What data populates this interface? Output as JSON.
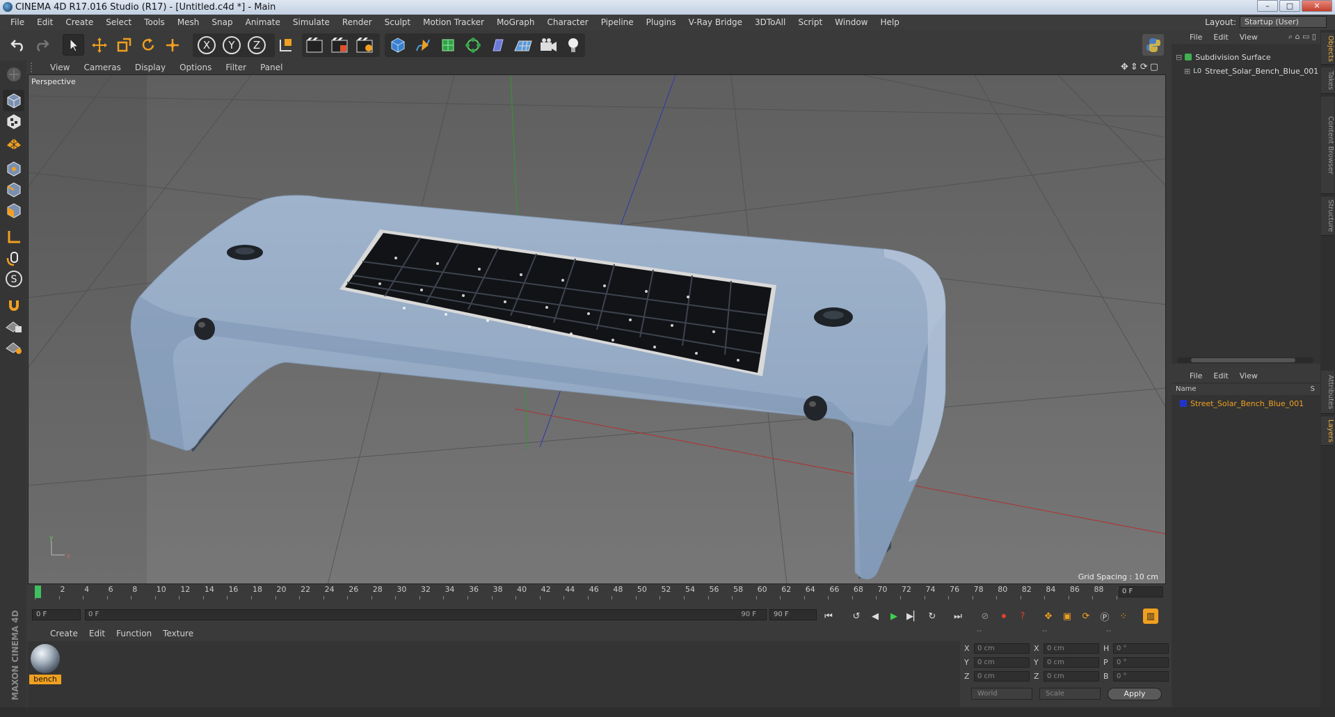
{
  "window": {
    "title": "CINEMA 4D R17.016 Studio (R17) - [Untitled.c4d *] - Main",
    "buttons": [
      "–",
      "□",
      "✕"
    ]
  },
  "menubar": {
    "items": [
      "File",
      "Edit",
      "Create",
      "Select",
      "Tools",
      "Mesh",
      "Snap",
      "Animate",
      "Simulate",
      "Render",
      "Sculpt",
      "Motion Tracker",
      "MoGraph",
      "Character",
      "Pipeline",
      "Plugins",
      "V-Ray Bridge",
      "3DToAll",
      "Script",
      "Window",
      "Help"
    ],
    "layout_label": "Layout:",
    "layout_value": "Startup (User)"
  },
  "toolbar": {
    "undo_icon": "undo-icon",
    "redo_icon": "redo-icon",
    "tools": [
      "select-icon",
      "move-icon",
      "scale-icon",
      "rotate-icon",
      "multi-icon"
    ],
    "axes": [
      "X",
      "Y",
      "Z"
    ],
    "accent": "#f0a020"
  },
  "viewport": {
    "menu": [
      "View",
      "Cameras",
      "Display",
      "Options",
      "Filter",
      "Panel"
    ],
    "label": "Perspective",
    "grid_spacing": "Grid Spacing : 10 cm",
    "background": "#6e6e6e",
    "bench_color": "#8fa5c0",
    "panel_color": "#151518"
  },
  "timeline": {
    "ticks": [
      "0",
      "2",
      "4",
      "6",
      "8",
      "10",
      "12",
      "14",
      "16",
      "18",
      "20",
      "22",
      "24",
      "26",
      "28",
      "30",
      "32",
      "34",
      "36",
      "38",
      "40",
      "42",
      "44",
      "46",
      "48",
      "50",
      "52",
      "54",
      "56",
      "58",
      "60",
      "62",
      "64",
      "66",
      "68",
      "70",
      "72",
      "74",
      "76",
      "78",
      "80",
      "82",
      "84",
      "86",
      "88",
      "90"
    ],
    "current_frame": "0 F",
    "start_frame": "0 F",
    "range_start": "0 F",
    "range_end": "90 F",
    "end_frame": "90 F"
  },
  "material_manager": {
    "menu": [
      "Create",
      "Edit",
      "Function",
      "Texture"
    ],
    "material_name": "bench"
  },
  "coordinates": {
    "headers": [
      "--",
      "--",
      "--"
    ],
    "rows": [
      {
        "a": "X",
        "av": "0 cm",
        "b": "X",
        "bv": "0 cm",
        "c": "H",
        "cv": "0 °"
      },
      {
        "a": "Y",
        "av": "0 cm",
        "b": "Y",
        "bv": "0 cm",
        "c": "P",
        "cv": "0 °"
      },
      {
        "a": "Z",
        "av": "0 cm",
        "b": "Z",
        "bv": "0 cm",
        "c": "B",
        "cv": "0 °"
      }
    ],
    "world": "World",
    "scale": "Scale",
    "apply": "Apply"
  },
  "objects_panel": {
    "menu": [
      "File",
      "Edit",
      "View"
    ],
    "items": [
      "Subdivision Surface",
      "Street_Solar_Bench_Blue_001"
    ]
  },
  "layers_panel": {
    "menu": [
      "File",
      "Edit",
      "View"
    ],
    "col_name": "Name",
    "col_s": "S",
    "item": "Street_Solar_Bench_Blue_001",
    "item_color": "#f0a020"
  },
  "side_tabs": [
    "Objects",
    "Takes",
    "Content Browser",
    "Structure",
    "Attributes",
    "Layers"
  ],
  "brand": "MAXON CINEMA 4D"
}
